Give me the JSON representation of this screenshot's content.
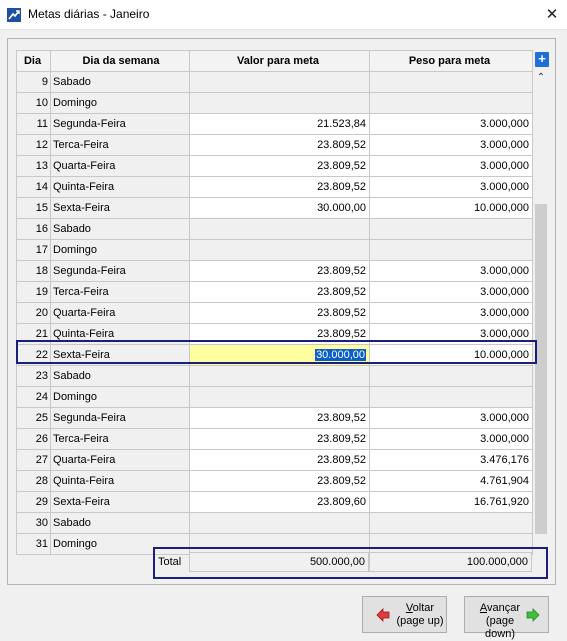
{
  "window": {
    "title": "Metas diárias - Janeiro",
    "close_glyph": "✕"
  },
  "grid": {
    "headers": {
      "dia": "Dia",
      "dow": "Dia da semana",
      "valor": "Valor para meta",
      "peso": "Peso para meta"
    },
    "add_glyph": "+",
    "editing_day": 22,
    "rows": [
      {
        "dia": "9",
        "dow": "Sabado",
        "valor": "",
        "peso": "",
        "weekend": true
      },
      {
        "dia": "10",
        "dow": "Domingo",
        "valor": "",
        "peso": "",
        "weekend": true
      },
      {
        "dia": "11",
        "dow": "Segunda-Feira",
        "valor": "21.523,84",
        "peso": "3.000,000",
        "weekend": false
      },
      {
        "dia": "12",
        "dow": "Terca-Feira",
        "valor": "23.809,52",
        "peso": "3.000,000",
        "weekend": false
      },
      {
        "dia": "13",
        "dow": "Quarta-Feira",
        "valor": "23.809,52",
        "peso": "3.000,000",
        "weekend": false
      },
      {
        "dia": "14",
        "dow": "Quinta-Feira",
        "valor": "23.809,52",
        "peso": "3.000,000",
        "weekend": false
      },
      {
        "dia": "15",
        "dow": "Sexta-Feira",
        "valor": "30.000,00",
        "peso": "10.000,000",
        "weekend": false
      },
      {
        "dia": "16",
        "dow": "Sabado",
        "valor": "",
        "peso": "",
        "weekend": true
      },
      {
        "dia": "17",
        "dow": "Domingo",
        "valor": "",
        "peso": "",
        "weekend": true
      },
      {
        "dia": "18",
        "dow": "Segunda-Feira",
        "valor": "23.809,52",
        "peso": "3.000,000",
        "weekend": false
      },
      {
        "dia": "19",
        "dow": "Terca-Feira",
        "valor": "23.809,52",
        "peso": "3.000,000",
        "weekend": false
      },
      {
        "dia": "20",
        "dow": "Quarta-Feira",
        "valor": "23.809,52",
        "peso": "3.000,000",
        "weekend": false
      },
      {
        "dia": "21",
        "dow": "Quinta-Feira",
        "valor": "23.809,52",
        "peso": "3.000,000",
        "weekend": false
      },
      {
        "dia": "22",
        "dow": "Sexta-Feira",
        "valor": "30.000,00",
        "peso": "10.000,000",
        "weekend": false
      },
      {
        "dia": "23",
        "dow": "Sabado",
        "valor": "",
        "peso": "",
        "weekend": true
      },
      {
        "dia": "24",
        "dow": "Domingo",
        "valor": "",
        "peso": "",
        "weekend": true
      },
      {
        "dia": "25",
        "dow": "Segunda-Feira",
        "valor": "23.809,52",
        "peso": "3.000,000",
        "weekend": false
      },
      {
        "dia": "26",
        "dow": "Terca-Feira",
        "valor": "23.809,52",
        "peso": "3.000,000",
        "weekend": false
      },
      {
        "dia": "27",
        "dow": "Quarta-Feira",
        "valor": "23.809,52",
        "peso": "3.476,176",
        "weekend": false
      },
      {
        "dia": "28",
        "dow": "Quinta-Feira",
        "valor": "23.809,52",
        "peso": "4.761,904",
        "weekend": false
      },
      {
        "dia": "29",
        "dow": "Sexta-Feira",
        "valor": "23.809,60",
        "peso": "16.761,920",
        "weekend": false
      },
      {
        "dia": "30",
        "dow": "Sabado",
        "valor": "",
        "peso": "",
        "weekend": true
      },
      {
        "dia": "31",
        "dow": "Domingo",
        "valor": "",
        "peso": "",
        "weekend": true
      }
    ]
  },
  "totals": {
    "label": "Total",
    "valor": "500.000,00",
    "peso": "100.000,000"
  },
  "buttons": {
    "back": {
      "line1": "Voltar",
      "line2": "(page up)",
      "mnemonic": "V"
    },
    "next": {
      "line1": "Avançar",
      "line2": "(page down)",
      "mnemonic": "A"
    }
  },
  "colors": {
    "editing_cell": "#ffff9f",
    "selection": "#0a5fc9",
    "highlight_border": "#1a1f7c"
  }
}
